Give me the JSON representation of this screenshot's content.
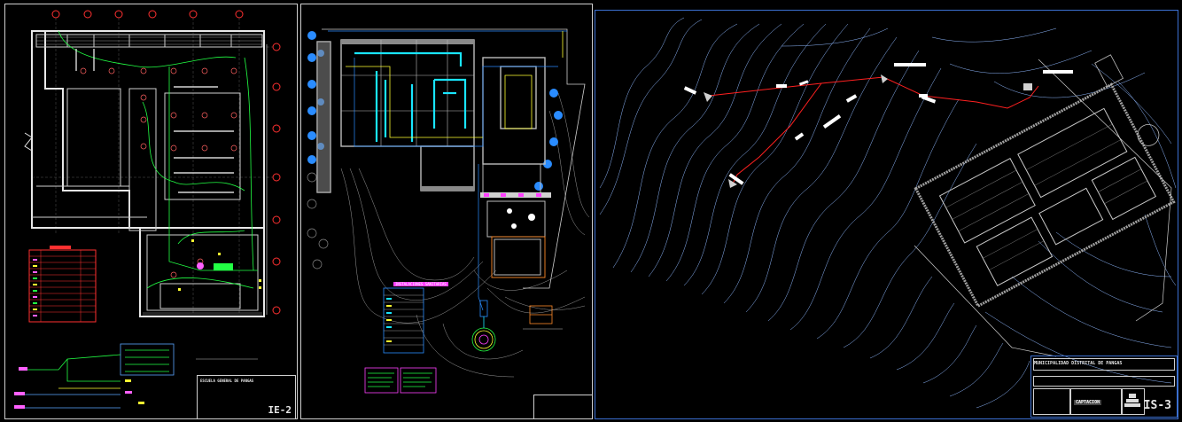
{
  "sheets": [
    {
      "id": "left",
      "titleblock": {
        "project": "ESCUELA GENERAL DE PANGAS",
        "sheet_code": "IE-2"
      }
    },
    {
      "id": "middle",
      "legend_title": "INSTALACIONES SANITARIAS",
      "titleblock": {
        "project": "",
        "sheet_code": ""
      }
    },
    {
      "id": "right",
      "titleblock": {
        "project": "MUNICIPALIDAD DISTRITAL DE PANGAS",
        "drawing": "CAPTACION",
        "sheet_code": "IS-3"
      },
      "route_labels": [
        "",
        "",
        "",
        "",
        "",
        "",
        "",
        ""
      ]
    }
  ],
  "colors": {
    "frame": "#cfcfcf",
    "wall": "#e8e8e8",
    "electric_green": "#22ff44",
    "electric_yellow": "#ffff30",
    "water_cyan": "#19e5ff",
    "contour_blue": "#5aa7ff",
    "route_red": "#ff2020",
    "tree_blue": "#2a8cff",
    "legend_red": "#ff3030",
    "magenta": "#ff40ff",
    "orange": "#ff8a2a"
  }
}
